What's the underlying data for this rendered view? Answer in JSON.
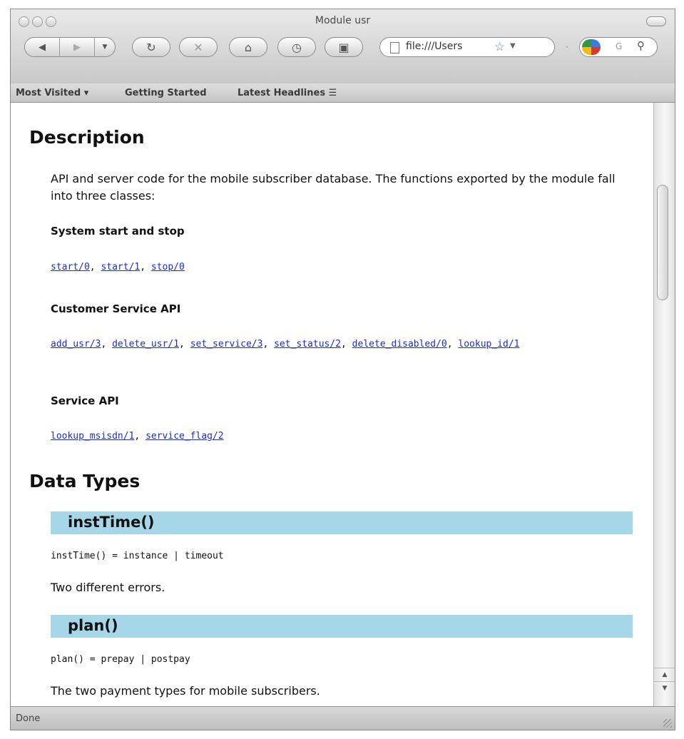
{
  "window": {
    "title": "Module usr"
  },
  "toolbar": {
    "back_icon": "back-arrow-icon",
    "forward_icon": "forward-arrow-icon",
    "reload_icon": "reload-icon",
    "stop_icon": "stop-icon",
    "home_icon": "home-icon",
    "history_icon": "history-clock-icon",
    "bookmark_icon": "bookmark-icon",
    "url": "file:///Users",
    "search_placeholder": "G"
  },
  "bookmarks": {
    "items": [
      "Most Visited ▾",
      "Getting Started",
      "Latest Headlines ☰"
    ]
  },
  "content": {
    "description_heading": "Description",
    "description_text": "API and server code for the mobile subscriber database. The functions exported by the module fall into three classes:",
    "sections": [
      {
        "title": "System start and stop",
        "links": [
          "start/0",
          "start/1",
          "stop/0"
        ]
      },
      {
        "title": "Customer Service API",
        "links": [
          "add_usr/3",
          "delete_usr/1",
          "set_service/3",
          "set_status/2",
          "delete_disabled/0",
          "lookup_id/1"
        ]
      },
      {
        "title": "Service API",
        "links": [
          "lookup_msisdn/1",
          "service_flag/2"
        ]
      }
    ],
    "data_types_heading": "Data Types",
    "types": [
      {
        "name": "instTime()",
        "definition": "instTime() = instance | timeout",
        "description": "Two different errors."
      },
      {
        "name": "plan()",
        "definition": "plan() = prepay | postpay",
        "description": "The two payment types for mobile subscribers."
      }
    ]
  },
  "status": {
    "text": "Done"
  },
  "colors": {
    "type_bar": "#a6d7e8",
    "link": "#1a2ad8"
  }
}
